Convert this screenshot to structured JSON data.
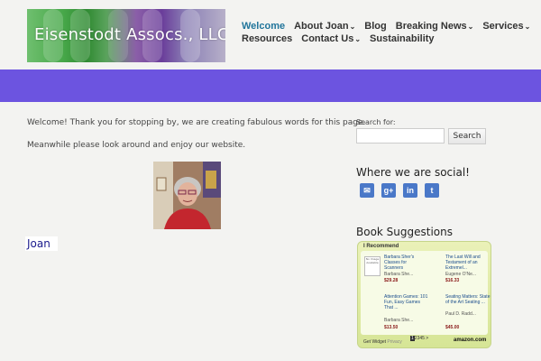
{
  "header": {
    "logo_text": "Eisenstodt Assocs., LLC"
  },
  "nav": {
    "row1": [
      {
        "label": "Welcome",
        "active": true,
        "dropdown": false
      },
      {
        "label": "About Joan",
        "active": false,
        "dropdown": true
      },
      {
        "label": "Blog",
        "active": false,
        "dropdown": false
      },
      {
        "label": "Breaking News",
        "active": false,
        "dropdown": true
      },
      {
        "label": "Services",
        "active": false,
        "dropdown": true
      }
    ],
    "row2": [
      {
        "label": "Resources",
        "active": false,
        "dropdown": false
      },
      {
        "label": "Contact Us",
        "active": false,
        "dropdown": true
      },
      {
        "label": "Sustainability",
        "active": false,
        "dropdown": false
      }
    ],
    "active_color": "#21759b"
  },
  "band": {
    "color": "#6c54e0"
  },
  "main": {
    "paragraph1": "Welcome!  Thank you for stopping by, we are creating fabulous words for this page.",
    "paragraph2": "Meanwhile please look around and enjoy our website.",
    "name_link": "Joan"
  },
  "sidebar": {
    "search": {
      "label": "Search for:",
      "value": "",
      "placeholder": "",
      "button_label": "Search"
    },
    "social": {
      "title": "Where we are social!",
      "items": [
        {
          "icon": "email-icon",
          "glyph": "✉",
          "color": "#4a78c8"
        },
        {
          "icon": "google-plus-icon",
          "glyph": "g+",
          "color": "#4a78c8"
        },
        {
          "icon": "linkedin-icon",
          "glyph": "in",
          "color": "#4a78c8"
        },
        {
          "icon": "twitter-icon",
          "glyph": "t",
          "color": "#4a78c8"
        }
      ]
    },
    "books": {
      "title": "Book Suggestions",
      "widget_header": "I Recommend",
      "items": [
        {
          "title": "Barbara Sher's Classes for Scanners",
          "author": "Barbara She...",
          "price": "$29.28",
          "thumb": "No Image Available"
        },
        {
          "title": "The Last Will and Testament of an Extremel...",
          "author": "Eugene O'Ne...",
          "price": "$16.33",
          "thumb": ""
        },
        {
          "title": "Attention Games: 101 Fun, Easy Games That ...",
          "author": "Barbara She...",
          "price": "$13.50",
          "thumb": ""
        },
        {
          "title": "Seating Matters: State of the Art Seating ...",
          "author": "Paul D. Radd...",
          "price": "$45.00",
          "thumb": ""
        }
      ],
      "pages": [
        "1",
        "2",
        "3",
        "4",
        "5"
      ],
      "current_page": "1",
      "next_label": ">",
      "get_widget": "Get Widget",
      "privacy": "Privacy",
      "amazon_label": "amazon.com"
    }
  }
}
